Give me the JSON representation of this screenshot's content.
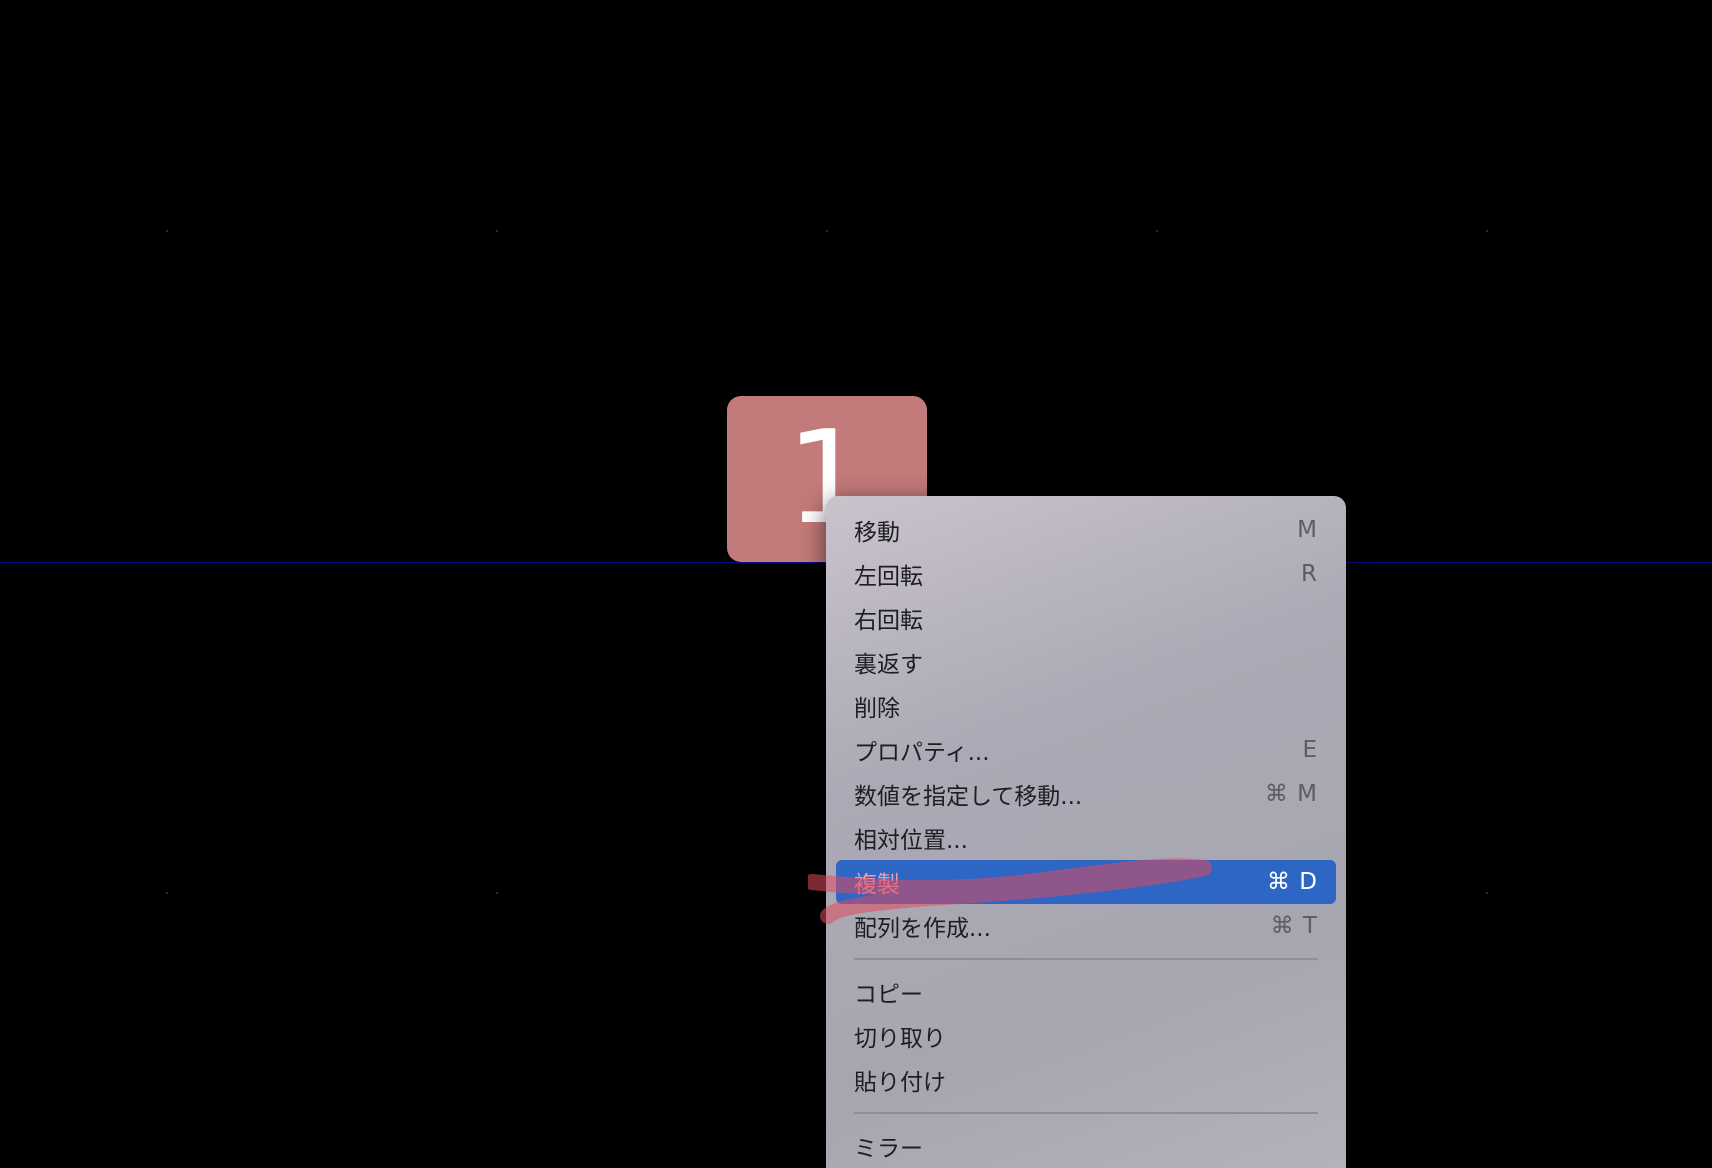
{
  "tile": {
    "label": "1",
    "color": "#c27a7a"
  },
  "menu": {
    "groups": [
      [
        {
          "label": "移動",
          "shortcut": "M"
        },
        {
          "label": "左回転",
          "shortcut": "R"
        },
        {
          "label": "右回転",
          "shortcut": ""
        },
        {
          "label": "裏返す",
          "shortcut": ""
        },
        {
          "label": "削除",
          "shortcut": ""
        },
        {
          "label": "プロパティ...",
          "shortcut": "E"
        },
        {
          "label": "数値を指定して移動...",
          "shortcut": "⌘ M"
        },
        {
          "label": "相対位置...",
          "shortcut": ""
        },
        {
          "label": "複製",
          "shortcut": "⌘ D",
          "selected": true
        },
        {
          "label": "配列を作成...",
          "shortcut": "⌘ T"
        }
      ],
      [
        {
          "label": "コピー",
          "shortcut": ""
        },
        {
          "label": "切り取り",
          "shortcut": ""
        },
        {
          "label": "貼り付け",
          "shortcut": ""
        }
      ],
      [
        {
          "label": "ミラー",
          "shortcut": ""
        }
      ]
    ],
    "highlight_color": "#2d66c4",
    "annotation_color": "#e0485c"
  }
}
